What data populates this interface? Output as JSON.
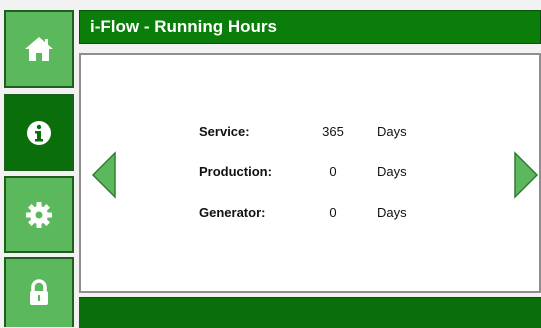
{
  "header": {
    "title": "i-Flow - Running Hours"
  },
  "sidebar": {
    "items": [
      {
        "icon": "home-icon"
      },
      {
        "icon": "info-icon"
      },
      {
        "icon": "gear-icon"
      },
      {
        "icon": "lock-icon"
      }
    ]
  },
  "hours": {
    "rows": [
      {
        "label": "Service:",
        "value": "365",
        "unit": "Days"
      },
      {
        "label": "Production:",
        "value": "0",
        "unit": "Days"
      },
      {
        "label": "Generator:",
        "value": "0",
        "unit": "Days"
      }
    ]
  },
  "colors": {
    "header_green": "#0a7d0a",
    "button_light_green": "#5cb85c",
    "button_dark_green": "#0a6e0a",
    "arrow_green": "#5cb85c"
  }
}
